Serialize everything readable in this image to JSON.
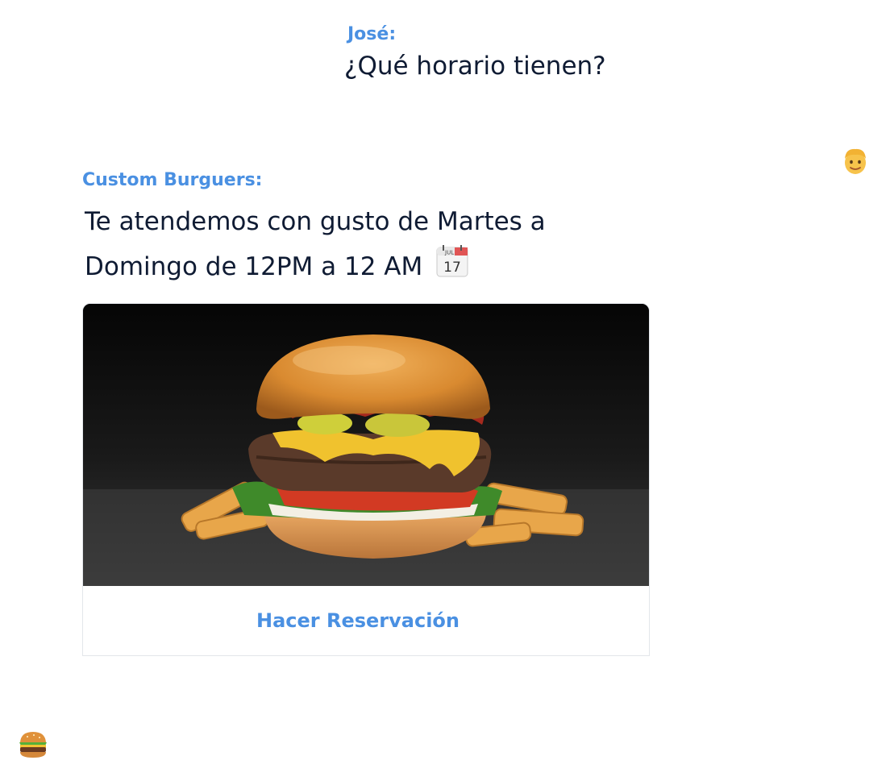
{
  "messages": {
    "user": {
      "sender": "José:",
      "text": "¿Qué horario tienen?",
      "avatar_icon": "man-face-icon"
    },
    "bot": {
      "sender": "Custom Burguers:",
      "text": "Te atendemos con gusto de Martes a Domingo de 12PM a 12 AM",
      "text_icon": "calendar-icon",
      "avatar_icon": "hamburger-icon",
      "card": {
        "image": "burger-photo",
        "button_label": "Hacer Reservación"
      }
    }
  },
  "calendar_icon": {
    "month": "JUL",
    "day": "17"
  },
  "colors": {
    "accent": "#4a90e2",
    "text": "#0f1b33",
    "card_border": "#e3e6ea"
  }
}
